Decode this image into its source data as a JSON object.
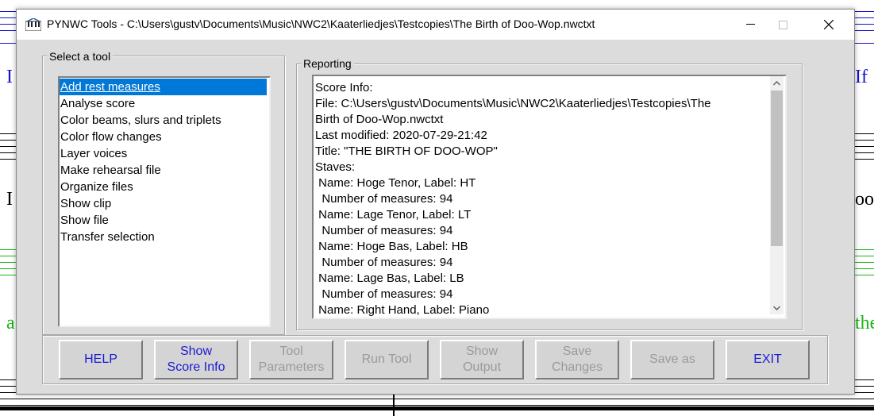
{
  "window": {
    "title": "PYNWC Tools - C:\\Users\\gustv\\Documents\\Music\\NWC2\\Kaaterliedjes\\Testcopies\\The Birth of Doo-Wop.nwctxt"
  },
  "background": {
    "left_lyrics": [
      "I",
      "I",
      "a"
    ],
    "right_lyrics": [
      "If",
      "oor",
      "the"
    ],
    "colors": {
      "blue": "#1515c9",
      "green": "#16b816"
    }
  },
  "tools": {
    "label": "Select a tool",
    "items": [
      "Add rest measures",
      "Analyse score",
      "Color beams, slurs and triplets",
      "Color flow changes",
      "Layer voices",
      "Make rehearsal file",
      "Organize files",
      "Show clip",
      "Show file",
      "Transfer selection"
    ],
    "selected_index": 0
  },
  "reporting": {
    "label": "Reporting",
    "lines": [
      "Score Info:",
      "File: C:\\Users\\gustv\\Documents\\Music\\NWC2\\Kaaterliedjes\\Testcopies\\The",
      "Birth of Doo-Wop.nwctxt",
      "Last modified: 2020-07-29-21:42",
      "Title: \"THE BIRTH OF DOO-WOP\"",
      "Staves:",
      " Name: Hoge Tenor, Label: HT",
      "  Number of measures: 94",
      " Name: Lage Tenor, Label: LT",
      "  Number of measures: 94",
      " Name: Hoge Bas, Label: HB",
      "  Number of measures: 94",
      " Name: Lage Bas, Label: LB",
      "  Number of measures: 94",
      " Name: Right Hand, Label: Piano"
    ]
  },
  "buttons": [
    {
      "lines": [
        "HELP"
      ],
      "enabled": true
    },
    {
      "lines": [
        "Show",
        "Score Info"
      ],
      "enabled": true
    },
    {
      "lines": [
        "Tool",
        "Parameters"
      ],
      "enabled": false
    },
    {
      "lines": [
        "Run Tool"
      ],
      "enabled": false
    },
    {
      "lines": [
        "Show",
        "Output"
      ],
      "enabled": false
    },
    {
      "lines": [
        "Save",
        "Changes"
      ],
      "enabled": false
    },
    {
      "lines": [
        "Save as"
      ],
      "enabled": false
    },
    {
      "lines": [
        "EXIT"
      ],
      "enabled": true
    }
  ],
  "accent_colors": {
    "selection": "#0078d7",
    "enabled_button_text": "#1a1ad4",
    "disabled_button_text": "#9a9a9a"
  }
}
